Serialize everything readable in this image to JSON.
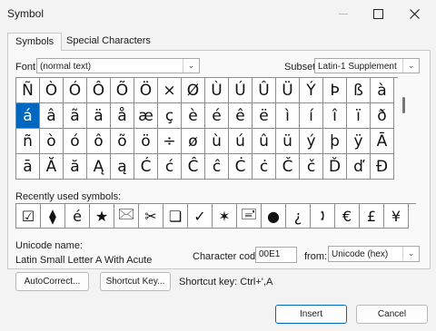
{
  "window": {
    "title": "Symbol"
  },
  "tabs": [
    "Symbols",
    "Special Characters"
  ],
  "font": {
    "label": "Font:",
    "value": "(normal text)"
  },
  "subset": {
    "label": "Subset:",
    "value": "Latin-1 Supplement"
  },
  "grid": [
    [
      "Ñ",
      "Ò",
      "Ó",
      "Ô",
      "Õ",
      "Ö",
      "×",
      "Ø",
      "Ù",
      "Ú",
      "Û",
      "Ü",
      "Ý",
      "Þ",
      "ß",
      "à"
    ],
    [
      "á",
      "â",
      "ã",
      "ä",
      "å",
      "æ",
      "ç",
      "è",
      "é",
      "ê",
      "ë",
      "ì",
      "í",
      "î",
      "ï",
      "ð"
    ],
    [
      "ñ",
      "ò",
      "ó",
      "ô",
      "õ",
      "ö",
      "÷",
      "ø",
      "ù",
      "ú",
      "û",
      "ü",
      "ý",
      "þ",
      "ÿ",
      "Ā"
    ],
    [
      "ā",
      "Ă",
      "ă",
      "Ą",
      "ą",
      "Ć",
      "ć",
      "Ĉ",
      "ĉ",
      "Ċ",
      "ċ",
      "Č",
      "č",
      "Ď",
      "ď",
      "Đ"
    ]
  ],
  "selected_symbol": "á",
  "recent": {
    "label": "Recently used symbols:",
    "symbols": [
      "☑",
      "⧫",
      "é",
      "★",
      "🖂",
      "✂",
      "❏",
      "✓",
      "✶",
      "🖃",
      "●",
      "¿",
      "🕽",
      "€",
      "£",
      "¥"
    ]
  },
  "unicode_name": {
    "label": "Unicode name:",
    "value": "Latin Small Letter A With Acute"
  },
  "char_code": {
    "label": "Character code:",
    "value": "00E1"
  },
  "from": {
    "label": "from:",
    "value": "Unicode (hex)"
  },
  "buttons": {
    "autocorrect": "AutoCorrect...",
    "shortcut_key": "Shortcut Key...",
    "insert": "Insert",
    "cancel": "Cancel"
  },
  "shortcut_text": "Shortcut key: Ctrl+',A"
}
